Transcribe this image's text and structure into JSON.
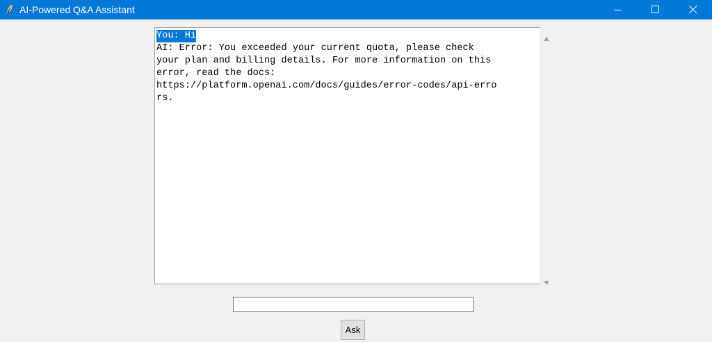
{
  "window": {
    "title": "AI-Powered Q&A Assistant",
    "icon": "feather-icon",
    "controls": [
      "minimize-icon",
      "maximize-icon",
      "close-icon"
    ]
  },
  "chat": {
    "lines": [
      "You: Hi",
      "AI: Error: You exceeded your current quota, please check",
      "your plan and billing details. For more information on this",
      "error, read the docs:",
      "https://platform.openai.com/docs/guides/error-codes/api-erro",
      "rs."
    ]
  },
  "input": {
    "value": "",
    "placeholder": ""
  },
  "ask_button": {
    "label": "Ask"
  },
  "colors": {
    "titlebar": "#0078d7",
    "background": "#f0f0f0",
    "selection": "#0078d7"
  }
}
